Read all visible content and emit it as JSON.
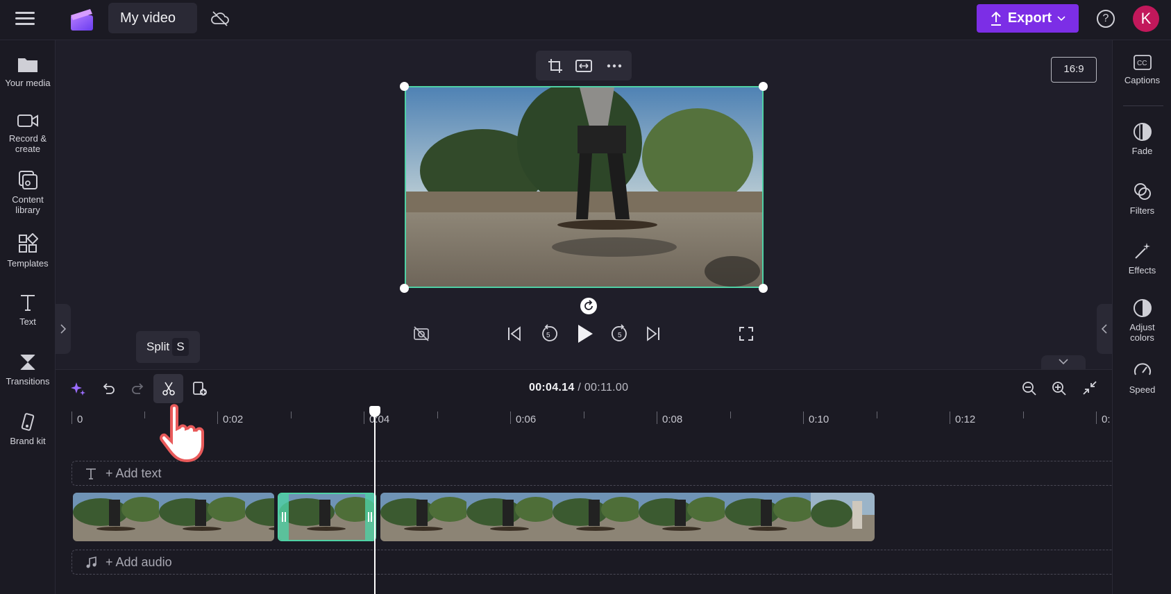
{
  "header": {
    "project_title": "My video",
    "export_label": "Export",
    "avatar_initial": "K",
    "help_label": "?"
  },
  "left_sidebar": {
    "items": [
      {
        "label": "Your media"
      },
      {
        "label_line1": "Record &",
        "label_line2": "create"
      },
      {
        "label_line1": "Content",
        "label_line2": "library"
      },
      {
        "label": "Templates"
      },
      {
        "label": "Text"
      },
      {
        "label": "Transitions"
      },
      {
        "label": "Brand kit"
      }
    ]
  },
  "right_sidebar": {
    "items": [
      {
        "label": "Captions"
      },
      {
        "label": "Fade"
      },
      {
        "label": "Filters"
      },
      {
        "label": "Effects"
      },
      {
        "label_line1": "Adjust",
        "label_line2": "colors"
      },
      {
        "label": "Speed"
      }
    ]
  },
  "preview": {
    "aspect_ratio": "16:9"
  },
  "timeline": {
    "tooltip_label": "Split",
    "tooltip_shortcut": "S",
    "current_time": "00:04.14",
    "separator": " / ",
    "total_time": "00:11.00",
    "ruler_labels": [
      "0",
      "0:02",
      "0:04",
      "0:06",
      "0:08",
      "0:10",
      "0:12",
      "0:"
    ],
    "add_text_label": "+ Add text",
    "add_audio_label": "+ Add audio"
  },
  "colors": {
    "accent": "#7c2ee6",
    "selection": "#4fd1a5",
    "avatar": "#c2185b"
  }
}
